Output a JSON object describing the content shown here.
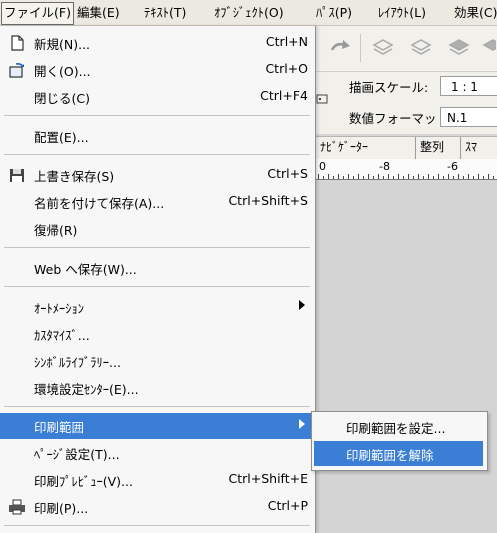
{
  "menubar": {
    "items": [
      {
        "label": "ファイル(F)"
      },
      {
        "label": "編集(E)"
      },
      {
        "label": "ﾃｷｽﾄ(T)"
      },
      {
        "label": "ｵﾌﾞｼﾞｪｸﾄ(O)"
      },
      {
        "label": "ﾊﾟｽ(P)"
      },
      {
        "label": "ﾚｲｱｳﾄ(L)"
      },
      {
        "label": "効果(C)"
      }
    ]
  },
  "properties": {
    "scale_label": "描画スケール:",
    "scale_value": "1 : 1",
    "format_label": "数値フォーマット:",
    "format_value": "N.1"
  },
  "panel_tabs": [
    {
      "label": "ﾅﾋﾞｹﾞｰﾀｰ"
    },
    {
      "label": "整列"
    },
    {
      "label": "ｽﾏ"
    }
  ],
  "ruler": {
    "labels": [
      "0",
      "-8",
      "-6"
    ]
  },
  "file_menu": {
    "new": {
      "label": "新規(N)...",
      "shortcut": "Ctrl+N"
    },
    "open": {
      "label": "開く(O)...",
      "shortcut": "Ctrl+O"
    },
    "close": {
      "label": "閉じる(C)",
      "shortcut": "Ctrl+F4"
    },
    "place": {
      "label": "配置(E)..."
    },
    "save": {
      "label": "上書き保存(S)",
      "shortcut": "Ctrl+S"
    },
    "save_as": {
      "label": "名前を付けて保存(A)...",
      "shortcut": "Ctrl+Shift+S"
    },
    "revert": {
      "label": "復帰(R)"
    },
    "save_web": {
      "label": "Web へ保存(W)..."
    },
    "automation": {
      "label": "ｵｰﾄﾒｰｼｮﾝ"
    },
    "customize": {
      "label": "ｶｽﾀﾏｲｽﾞ..."
    },
    "symbol_library": {
      "label": "ｼﾝﾎﾞﾙﾗｲﾌﾞﾗﾘｰ..."
    },
    "preferences": {
      "label": "環境設定ｾﾝﾀｰ(E)..."
    },
    "print_area": {
      "label": "印刷範囲"
    },
    "page_setup": {
      "label": "ﾍﾟｰｼﾞ設定(T)..."
    },
    "print_preview": {
      "label": "印刷ﾌﾟﾚﾋﾞｭｰ(V)...",
      "shortcut": "Ctrl+Shift+E"
    },
    "print": {
      "label": "印刷(P)...",
      "shortcut": "Ctrl+P"
    }
  },
  "print_area_submenu": {
    "set": {
      "label": "印刷範囲を設定..."
    },
    "clear": {
      "label": "印刷範囲を解除"
    }
  },
  "colors": {
    "highlight": "#3a7fd5"
  }
}
